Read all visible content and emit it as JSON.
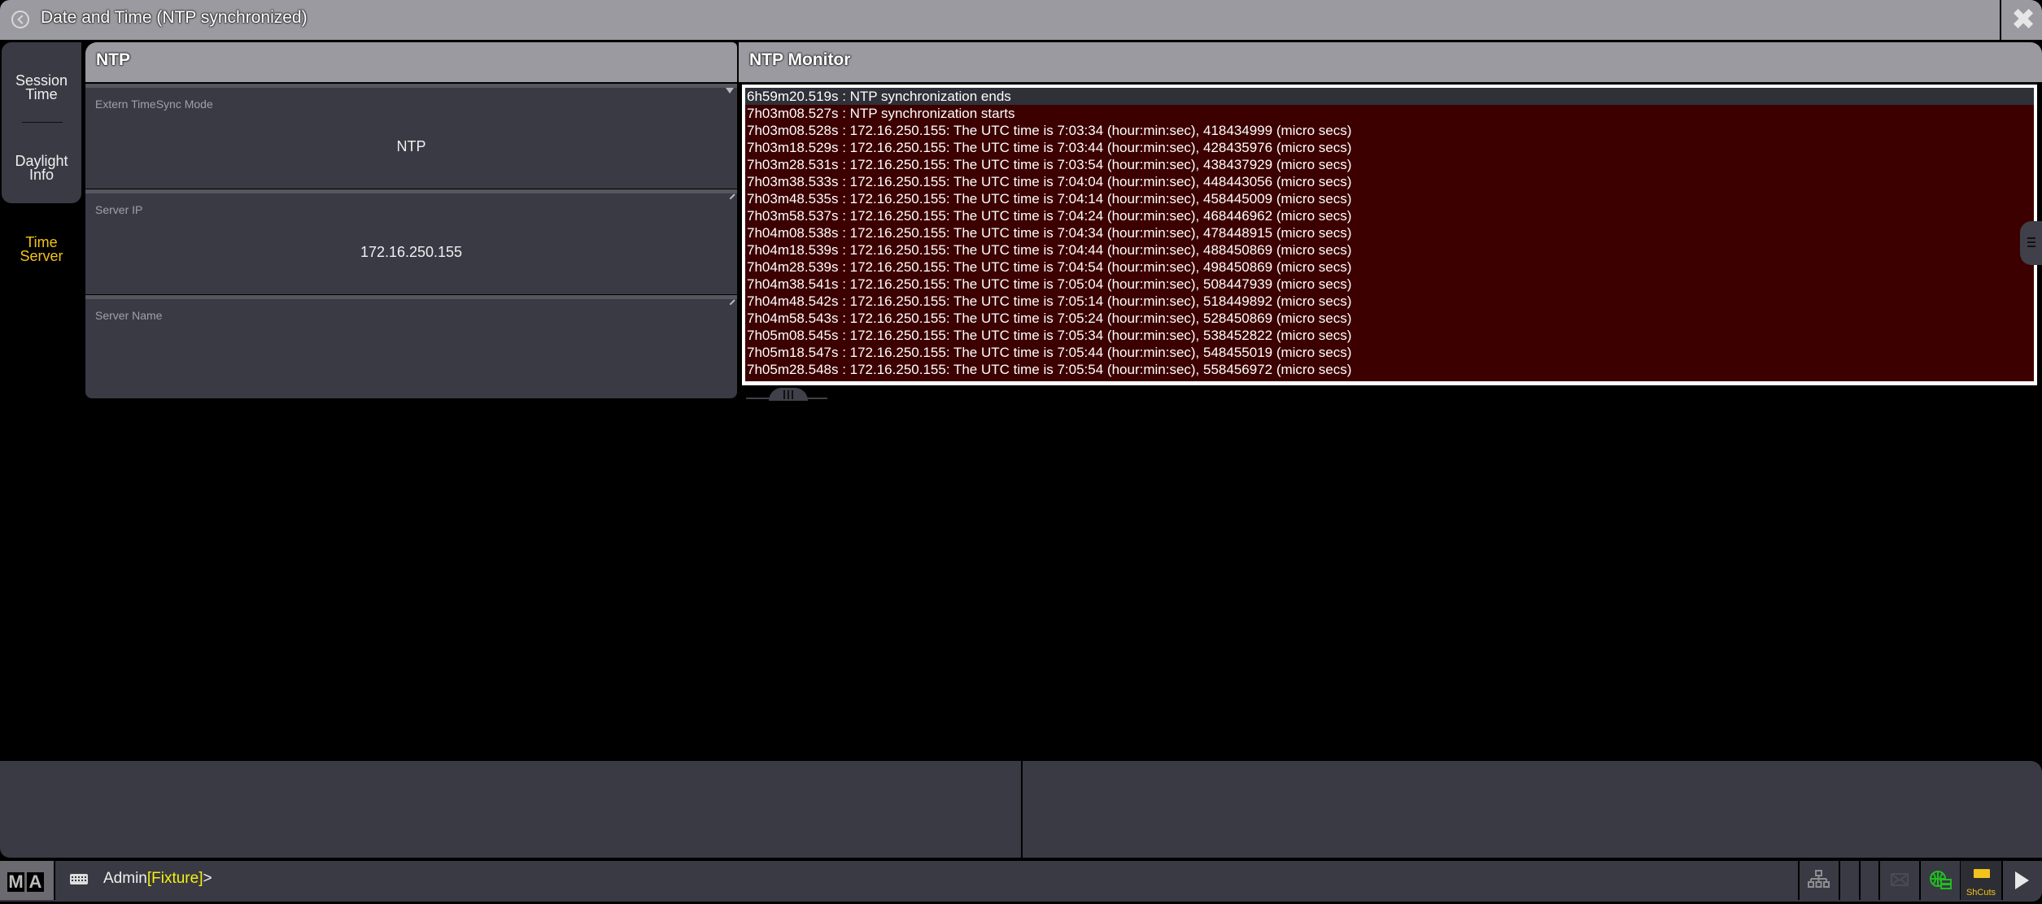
{
  "window": {
    "title": "Date and Time (NTP synchronized)",
    "close_icon": "close-icon",
    "back_icon": "back-circle-icon"
  },
  "sidebar": {
    "tabs": [
      {
        "label_line1": "Session",
        "label_line2": "Time",
        "active": false
      },
      {
        "label_line1": "Daylight",
        "label_line2": "Info",
        "active": false
      },
      {
        "label_line1": "Time",
        "label_line2": "Server",
        "active": true
      }
    ]
  },
  "ntp_panel": {
    "title": "NTP",
    "fields": [
      {
        "label": "Extern TimeSync Mode",
        "value": "NTP",
        "control": "dropdown"
      },
      {
        "label": "Server IP",
        "value": "172.16.250.155",
        "control": "edit"
      },
      {
        "label": "Server Name",
        "value": "",
        "control": "edit"
      }
    ]
  },
  "monitor_panel": {
    "title": "NTP Monitor",
    "log": [
      "6h59m20.519s : NTP synchronization ends",
      "7h03m08.527s : NTP synchronization starts",
      "7h03m08.528s : 172.16.250.155: The UTC time is 7:03:34 (hour:min:sec), 418434999 (micro secs)",
      "7h03m18.529s : 172.16.250.155: The UTC time is 7:03:44 (hour:min:sec), 428435976 (micro secs)",
      "7h03m28.531s : 172.16.250.155: The UTC time is 7:03:54 (hour:min:sec), 438437929 (micro secs)",
      "7h03m38.533s : 172.16.250.155: The UTC time is 7:04:04 (hour:min:sec), 448443056 (micro secs)",
      "7h03m48.535s : 172.16.250.155: The UTC time is 7:04:14 (hour:min:sec), 458445009 (micro secs)",
      "7h03m58.537s : 172.16.250.155: The UTC time is 7:04:24 (hour:min:sec), 468446962 (micro secs)",
      "7h04m08.538s : 172.16.250.155: The UTC time is 7:04:34 (hour:min:sec), 478448915 (micro secs)",
      "7h04m18.539s : 172.16.250.155: The UTC time is 7:04:44 (hour:min:sec), 488450869 (micro secs)",
      "7h04m28.539s : 172.16.250.155: The UTC time is 7:04:54 (hour:min:sec), 498450869 (micro secs)",
      "7h04m38.541s : 172.16.250.155: The UTC time is 7:05:04 (hour:min:sec), 508447939 (micro secs)",
      "7h04m48.542s : 172.16.250.155: The UTC time is 7:05:14 (hour:min:sec), 518449892 (micro secs)",
      "7h04m58.543s : 172.16.250.155: The UTC time is 7:05:24 (hour:min:sec), 528450869 (micro secs)",
      "7h05m08.545s : 172.16.250.155: The UTC time is 7:05:34 (hour:min:sec), 538452822 (micro secs)",
      "7h05m18.547s : 172.16.250.155: The UTC time is 7:05:44 (hour:min:sec), 548455019 (micro secs)",
      "7h05m28.548s : 172.16.250.155: The UTC time is 7:05:54 (hour:min:sec), 558456972 (micro secs)"
    ]
  },
  "command_bar": {
    "logo_letters": [
      "M",
      "A"
    ],
    "keyboard_icon": "keyboard-icon",
    "user": "Admin",
    "context": "[Fixture]",
    "prompt": ">",
    "tray": {
      "network_icon": "network-tree-icon",
      "mail_icon": "mail-icon",
      "globe_icon": "globe-server-icon",
      "shortcuts_label": "ShCuts",
      "play_icon": "play-icon"
    }
  },
  "colors": {
    "accent_yellow": "#f2c31a",
    "log_background": "#3c0000",
    "panel_bg": "#393a44",
    "header_gray": "#9a9aa0",
    "globe_green": "#1fbf1f",
    "context_yellow": "#f5f10e"
  }
}
